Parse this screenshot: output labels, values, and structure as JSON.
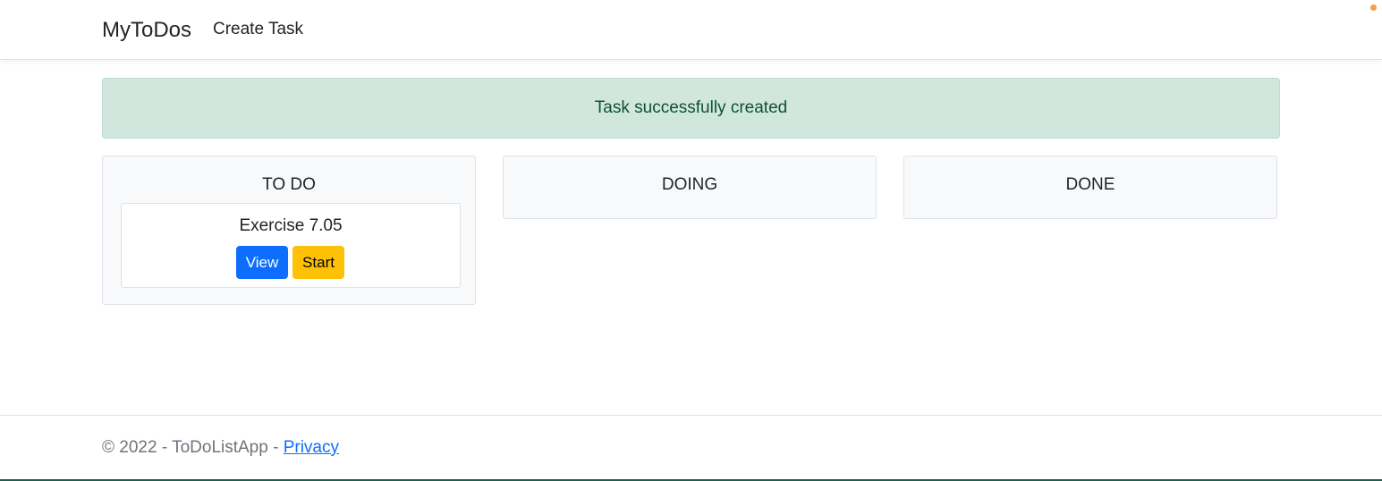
{
  "navbar": {
    "brand": "MyToDos",
    "links": [
      {
        "label": "Create Task"
      }
    ]
  },
  "alert": {
    "message": "Task successfully created"
  },
  "board": {
    "columns": [
      {
        "title": "TO DO",
        "tasks": [
          {
            "title": "Exercise 7.05",
            "view_label": "View",
            "start_label": "Start"
          }
        ]
      },
      {
        "title": "DOING",
        "tasks": []
      },
      {
        "title": "DONE",
        "tasks": []
      }
    ]
  },
  "footer": {
    "copyright": "© 2022 - ToDoListApp - ",
    "privacy_label": "Privacy"
  },
  "colors": {
    "primary": "#0d6efd",
    "warning": "#ffc107",
    "success_bg": "#d1e7dd",
    "success_text": "#0f5132"
  }
}
